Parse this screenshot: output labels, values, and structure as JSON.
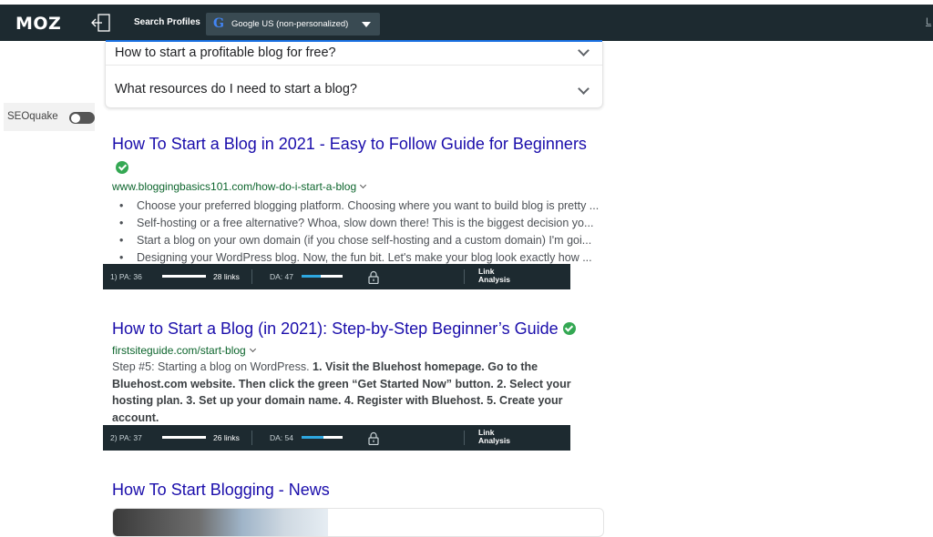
{
  "toolbar": {
    "logo": "MOZ",
    "search_profiles_label": "Search Profiles",
    "profile_icon": "G",
    "profile_value": "Google US (non-personalized)",
    "edge_text": "L"
  },
  "faq": [
    "How to start a profitable blog for free?",
    "What resources do I need to start a blog?"
  ],
  "seoquake": {
    "label": "SEOquake",
    "enabled": false
  },
  "results": [
    {
      "title": "How To Start a Blog in 2021 - Easy to Follow Guide for Beginners",
      "url": "www.bloggingbasics101.com/how-do-i-start-a-blog",
      "bullets": [
        "Choose your preferred blogging platform. Choosing where you want to build blog is pretty ...",
        "Self-hosting or a free alternative? Whoa, slow down there! This is the biggest decision yo...",
        "Start a blog on your own domain (if you chose self-hosting and a custom domain) I'm goi...",
        "Designing your WordPress blog. Now, the fun bit. Let's make your blog look exactly how ..."
      ],
      "metrics": {
        "pa": "1) PA: 36",
        "links": "28 links",
        "da": "DA: 47",
        "pa_value": 36,
        "da_value": 47,
        "analysis": [
          "Link",
          "Analysis"
        ]
      }
    },
    {
      "title": "How to Start a Blog (in 2021): Step-by-Step Beginner’s Guide",
      "url": "firstsiteguide.com/start-blog",
      "snippet_plain": "Step #5: Starting a blog on WordPress. ",
      "snippet_bold": "1. Visit the Bluehost homepage. Go to the Bluehost.com website. Then click the green “Get Started Now” button. 2. Select your hosting plan. 3. Set up your domain name. 4. Register with Bluehost. 5. Create your account.",
      "metrics": {
        "pa": "2) PA: 37",
        "links": "26 links",
        "da": "DA: 54",
        "pa_value": 37,
        "da_value": 54,
        "analysis": [
          "Link",
          "Analysis"
        ]
      }
    }
  ],
  "news": {
    "title": "How To Start Blogging - News"
  },
  "colors": {
    "toolbar_bg": "#1d2a30",
    "link": "#1a0dab",
    "url": "#0d652d",
    "da_fill": "#2ea7e0",
    "verified": "#34a853"
  }
}
